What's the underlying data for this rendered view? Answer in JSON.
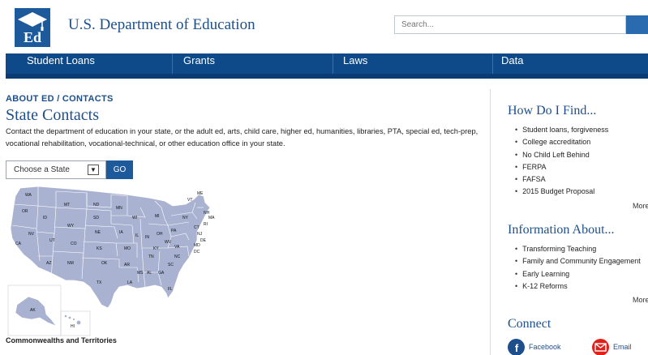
{
  "header": {
    "logo_text": "Ed",
    "site_title": "U.S. Department of Education",
    "search_placeholder": "Search..."
  },
  "nav": [
    {
      "label": "Student Loans"
    },
    {
      "label": "Grants"
    },
    {
      "label": "Laws"
    },
    {
      "label": "Data"
    }
  ],
  "breadcrumb": "ABOUT ED / CONTACTS",
  "page_title": "State Contacts",
  "intro": "Contact the department of education in your state, or the adult ed, arts, child care, higher ed, humanities, libraries, PTA, special ed, tech-prep, vocational rehabilitation, vocational-technical, or other education office in your state.",
  "state_picker": {
    "selected": "Choose a State",
    "go_label": "GO"
  },
  "map": {
    "state_labels": [
      "WA",
      "OR",
      "CA",
      "NV",
      "ID",
      "MT",
      "WY",
      "UT",
      "AZ",
      "CO",
      "NM",
      "ND",
      "SD",
      "NE",
      "KS",
      "OK",
      "TX",
      "MN",
      "IA",
      "MO",
      "AR",
      "LA",
      "WI",
      "IL",
      "MS",
      "AL",
      "TN",
      "KY",
      "IN",
      "MI",
      "OH",
      "GA",
      "FL",
      "SC",
      "NC",
      "VA",
      "WV",
      "PA",
      "NY",
      "VT",
      "NH",
      "ME",
      "MA",
      "RI",
      "CT",
      "NJ",
      "DE",
      "MD",
      "DC",
      "AK",
      "HI"
    ],
    "fill_color": "#a9b3d1"
  },
  "territories_heading": "Commonwealths and Territories",
  "sidebar": {
    "how_do_i_find": {
      "heading": "How Do I Find...",
      "items": [
        "Student loans, forgiveness",
        "College accreditation",
        "No Child Left Behind",
        "FERPA",
        "FAFSA",
        "2015 Budget Proposal"
      ],
      "more": "More"
    },
    "information_about": {
      "heading": "Information About...",
      "items": [
        "Transforming Teaching",
        "Family and Community Engagement",
        "Early Learning",
        "K-12 Reforms"
      ],
      "more": "More"
    },
    "connect": {
      "heading": "Connect",
      "facebook_label": "Facebook",
      "email_label": "Email"
    }
  },
  "colors": {
    "brand_blue": "#1d4f8c",
    "nav_blue": "#0e4a8a",
    "email_red": "#e0201a"
  }
}
